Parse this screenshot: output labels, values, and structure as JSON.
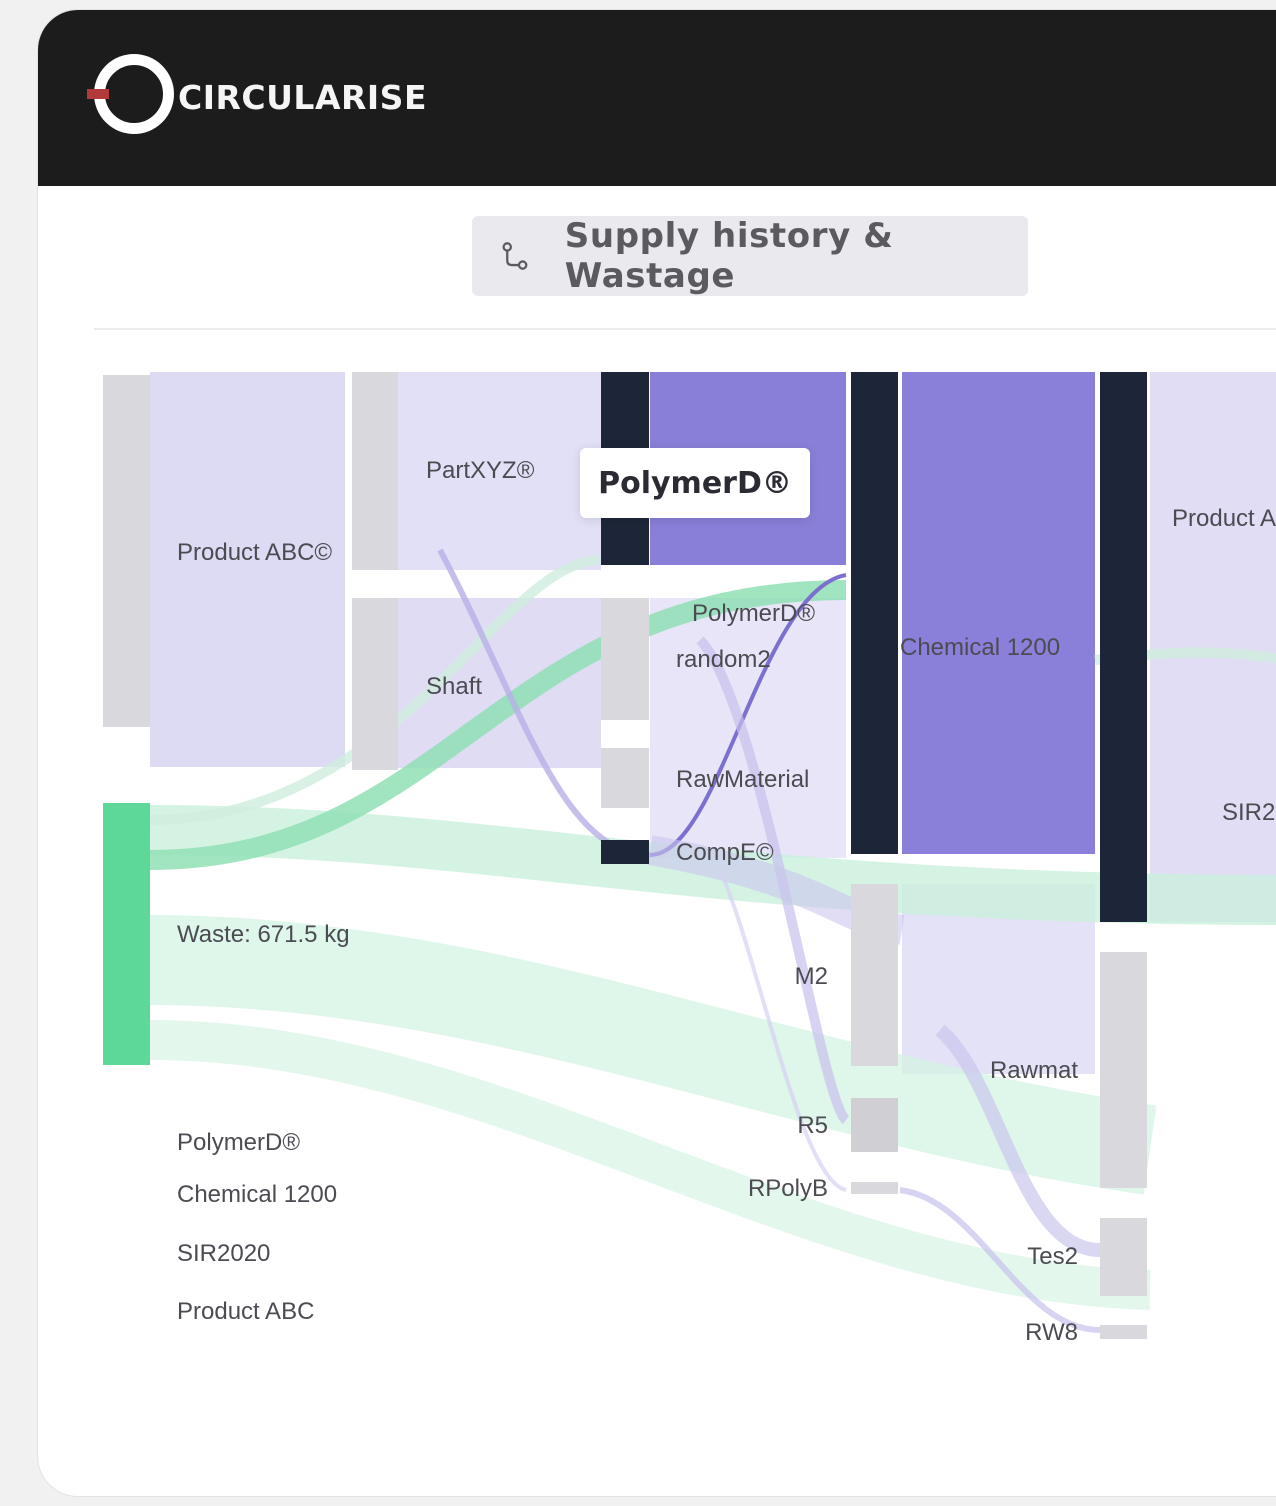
{
  "brand": {
    "name": "CIRCULARISE"
  },
  "header": {
    "tab_label": "Supply history & Wastage",
    "tab_icon": "route-icon"
  },
  "tooltip": {
    "label": "PolymerD®"
  },
  "colors": {
    "top_bar": "#1c1c1d",
    "node_dark": "#1d2638",
    "node_gray": "#d9d8dc",
    "node_waste": "#5dd898",
    "flow_lavender": "#d6d3f2",
    "flow_purple": "#8a7fd8",
    "flow_green": "#b9ecd2"
  },
  "sankey": {
    "labels": {
      "product_abc_c": "Product ABC©",
      "waste": "Waste: 671.5 kg",
      "partxyz": "PartXYZ®",
      "shaft": "Shaft",
      "polymerd_mid": "PolymerD®",
      "random2": "random2",
      "rawmaterial": "RawMaterial",
      "compe": "CompE©",
      "m2": "M2",
      "r5": "R5",
      "rpolyb": "RPolyB",
      "chemical_1200": "Chemical 1200",
      "rawmat": "Rawmat",
      "tes2": "Tes2",
      "rw8": "RW8",
      "product_right": "Product A",
      "sir_right": "SIR2"
    },
    "legend": [
      "PolymerD®",
      "Chemical 1200",
      "SIR2020",
      "Product ABC"
    ]
  }
}
